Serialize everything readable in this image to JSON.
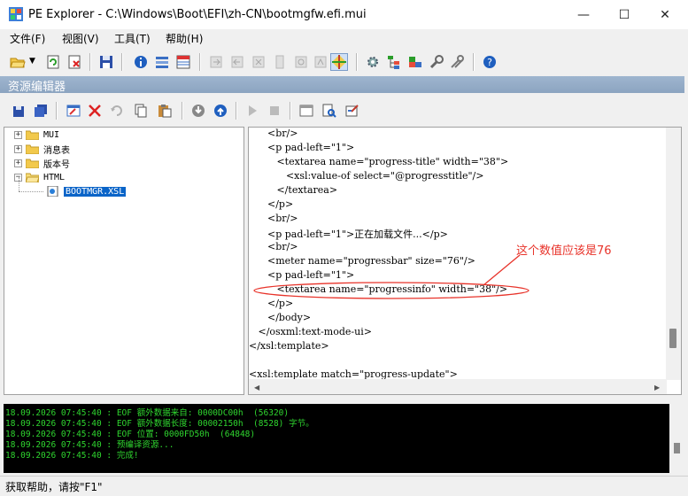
{
  "window": {
    "title": "PE Explorer - C:\\Windows\\Boot\\EFI\\zh-CN\\bootmgfw.efi.mui",
    "minimize_glyph": "—",
    "maximize_glyph": "☐",
    "close_glyph": "✕"
  },
  "menu": [
    {
      "label": "文件(F)"
    },
    {
      "label": "视图(V)"
    },
    {
      "label": "工具(T)"
    },
    {
      "label": "帮助(H)"
    }
  ],
  "section_header": "资源编辑器",
  "tree": {
    "items": [
      {
        "label": "MUI",
        "expander": "+"
      },
      {
        "label": "消息表",
        "expander": "+"
      },
      {
        "label": "版本号",
        "expander": "+"
      },
      {
        "label": "HTML",
        "expander": "−"
      },
      {
        "label": "BOOTMGR.XSL"
      }
    ]
  },
  "editor": {
    "lines": [
      "      <br/>",
      "      <p pad-left=\"1\">",
      "         <textarea name=\"progress-title\" width=\"38\">",
      "            <xsl:value-of select=\"@progresstitle\"/>",
      "         </textarea>",
      "      </p>",
      "      <br/>",
      "      <p pad-left=\"1\">正在加载文件...</p>",
      "      <br/>",
      "      <meter name=\"progressbar\" size=\"76\"/>",
      "      <p pad-left=\"1\">",
      "         <textarea name=\"progressinfo\" width=\"38\"/>",
      "      </p>",
      "      </body>",
      "   </osxml:text-mode-ui>",
      "</xsl:template>",
      "",
      "<xsl:template match=\"progress-update\">"
    ],
    "annotation": "这个数值应该是76",
    "annotation_color": "#e8332a"
  },
  "log": {
    "lines": [
      "18.09.2026 07:45:40 : EOF 额外数据来自: 0000DC00h  (56320)",
      "18.09.2026 07:45:40 : EOF 额外数据长度: 00002150h  (8528) 字节。",
      "18.09.2026 07:45:40 : EOF 位置: 0000FD50h  (64848)",
      "18.09.2026 07:45:40 : 预编译资源...",
      "18.09.2026 07:45:40 : 完成!"
    ]
  },
  "status": "获取帮助，请按\"F1\""
}
